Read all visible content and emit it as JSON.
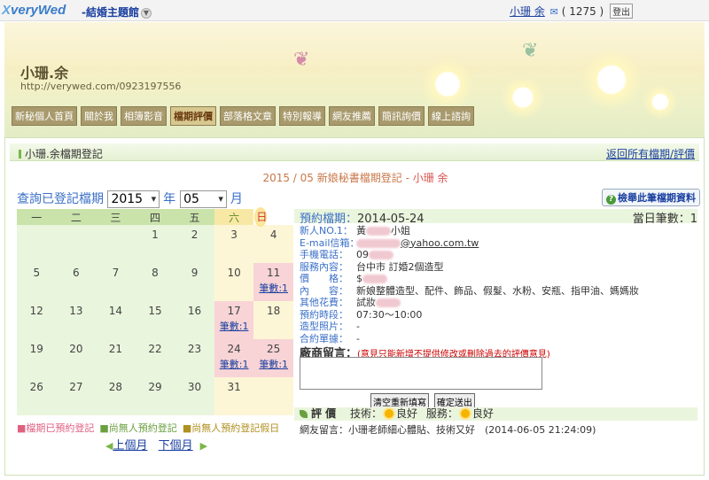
{
  "topbar": {
    "logo_mark": "X",
    "logo_text": "veryWed",
    "site_menu": "-結婚主題館",
    "user_name": "小珊 余",
    "mail_count": "( 1275 )",
    "logout_label": "登出"
  },
  "header": {
    "owner_name": "小珊.余",
    "owner_url": "http://verywed.com/0923197556",
    "tabs": [
      "新秘個人首頁",
      "關於我",
      "相簿影音",
      "檔期評價",
      "部落格文章",
      "特別報導",
      "網友推薦",
      "簡訊詢價",
      "線上諮詢"
    ],
    "active_tab": "檔期評價"
  },
  "panel": {
    "title": "小珊.余檔期登記",
    "back_link": "返回所有檔期/評價",
    "month_title": "2015 / 05 新娘秘書檔期登記 - ",
    "month_owner": "小珊 余",
    "query_label": "查詢已登記檔期",
    "year_value": "2015",
    "year_unit": "年",
    "month_value": "05",
    "month_unit": "月",
    "report_button": "檢舉此筆檔期資料"
  },
  "calendar": {
    "weekdays": [
      "一",
      "二",
      "三",
      "四",
      "五",
      "六",
      "日"
    ],
    "weeks": [
      [
        {
          "d": ""
        },
        {
          "d": ""
        },
        {
          "d": ""
        },
        {
          "d": "1"
        },
        {
          "d": "2"
        },
        {
          "d": "3"
        },
        {
          "d": "4"
        }
      ],
      [
        {
          "d": "5"
        },
        {
          "d": "6"
        },
        {
          "d": "7"
        },
        {
          "d": "8"
        },
        {
          "d": "9"
        },
        {
          "d": "10"
        },
        {
          "d": "11",
          "c": "筆數:1"
        }
      ],
      [
        {
          "d": "12"
        },
        {
          "d": "13"
        },
        {
          "d": "14"
        },
        {
          "d": "15"
        },
        {
          "d": "16"
        },
        {
          "d": "17",
          "c": "筆數:1"
        },
        {
          "d": "18"
        }
      ],
      [
        {
          "d": "19"
        },
        {
          "d": "20"
        },
        {
          "d": "21"
        },
        {
          "d": "22"
        },
        {
          "d": "23"
        },
        {
          "d": "24",
          "c": "筆數:1"
        },
        {
          "d": "25",
          "c": "筆數:1"
        }
      ],
      [
        {
          "d": "26"
        },
        {
          "d": "27"
        },
        {
          "d": "28"
        },
        {
          "d": "29"
        },
        {
          "d": "30"
        },
        {
          "d": "31"
        },
        {
          "d": ""
        }
      ]
    ],
    "legend": [
      "■檔期已預約登記",
      "■尚無人預約登記",
      "■尚無人預約登記假日"
    ],
    "prev_month": "上個月",
    "next_month": "下個月"
  },
  "detail": {
    "date_label": "預約檔期：",
    "date_value": "2014-05-24",
    "count_label": "當日筆數：",
    "count_value": "1",
    "rows": [
      {
        "label": "新人NO.1：",
        "value": "黃",
        "tail": "小姐"
      },
      {
        "label": "E-mail信箱：",
        "value": "",
        "tail": "@yahoo.com.tw"
      },
      {
        "label": "手機電話：",
        "value": "09",
        "tail": ""
      },
      {
        "label": "服務內容：",
        "value": "台中市 訂婚2個造型",
        "tail": ""
      },
      {
        "label": "價　　格：",
        "value": "$",
        "tail": ""
      },
      {
        "label": "內　　容：",
        "value": "新娘整體造型、配件、飾品、假髮、水粉、安瓶、指甲油、媽媽妝",
        "tail": ""
      },
      {
        "label": "其他花費：",
        "value": "試妝",
        "tail": ""
      },
      {
        "label": "預約時段：",
        "value": "07:30～10:00",
        "tail": ""
      },
      {
        "label": "造型照片：",
        "value": "-",
        "tail": ""
      },
      {
        "label": "合約單據：",
        "value": "-",
        "tail": ""
      }
    ],
    "message_label": "廠商留言：",
    "message_note": "(意見只能新增不提供修改或刪除過去的評價意見)",
    "clear_button": "清空重新填寫",
    "submit_button": "確定送出",
    "rating_label": "評 價",
    "skill_label": "技術：",
    "skill_value": "良好",
    "service_label": "服務：",
    "service_value": "良好",
    "review_text": "網友留言：小珊老師細心體貼、技術又好　(2014-06-05 21:24:09)"
  },
  "colors": {
    "accent_green": "#7ab648",
    "link_blue": "#1a3fa0",
    "booked_pink": "#f8d4d6"
  }
}
